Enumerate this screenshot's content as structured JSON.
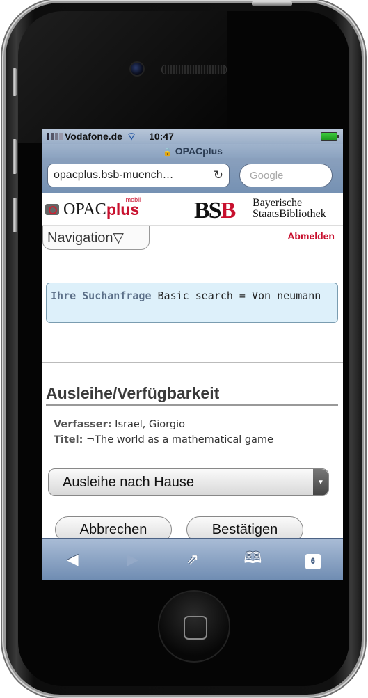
{
  "status": {
    "carrier": "Vodafone.de",
    "time": "10:47"
  },
  "browser": {
    "title": "OPACplus",
    "url": "opacplus.bsb-muench…",
    "search_placeholder": "Google"
  },
  "logos": {
    "opac_text": "OPAC",
    "opac_plus": "plus",
    "opac_mobil": "mobil",
    "bsb_text_1": "BS",
    "bsb_text_2": "B",
    "bayer_line1": "Bayerische",
    "bayer_line2": "StaatsBibliothek"
  },
  "nav": {
    "navigation_label": "Navigation▽",
    "logout_label": "Abmelden"
  },
  "query": {
    "label": "Ihre Suchanfrage",
    "text": "Basic search = Von neumann"
  },
  "section": {
    "heading": "Ausleihe/Verfügbarkeit"
  },
  "record": {
    "author_label": "Verfasser:",
    "author": "Israel, Giorgio",
    "title_label": "Titel:",
    "title": "¬The world as a mathematical game"
  },
  "form": {
    "selected_option": "Ausleihe nach Hause",
    "cancel_label": "Abbrechen",
    "confirm_label": "Bestätigen"
  },
  "toolbar": {
    "tabs_count": "6",
    "icons": [
      "back-icon",
      "forward-icon",
      "share-icon",
      "bookmarks-icon",
      "tabs-icon"
    ]
  },
  "colors": {
    "accent_red": "#c8102e",
    "query_bg": "#ddf0fa",
    "toolbar_blue": "#6f8cb2"
  }
}
